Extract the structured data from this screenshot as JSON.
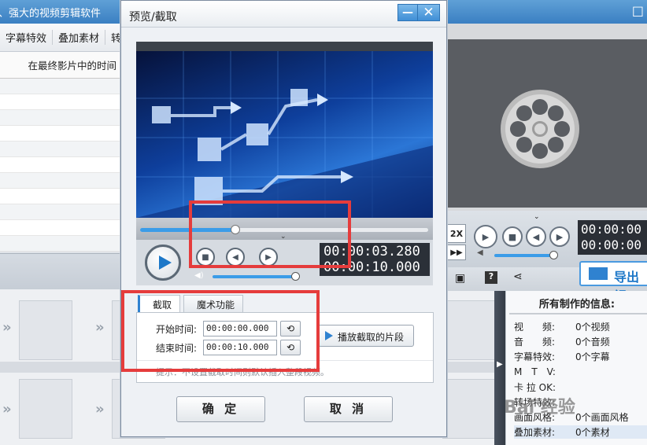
{
  "app": {
    "title": "、强大的视频剪辑软件",
    "tabs": [
      "字幕特效",
      "叠加素材",
      "转"
    ],
    "column_header": "在最终影片中的时间"
  },
  "preview": {
    "time_current": "00:00:00",
    "time_total": "00:00:00",
    "speed_label": "2X",
    "export_label": "导出视"
  },
  "info": {
    "title": "所有制作的信息:",
    "rows": [
      {
        "label": "视　　频:",
        "value": "0个视频"
      },
      {
        "label": "音　　频:",
        "value": "0个音频"
      },
      {
        "label": "字幕特效:",
        "value": "0个字幕"
      },
      {
        "label": "M　T　V:",
        "value": ""
      },
      {
        "label": "卡 拉 OK:",
        "value": ""
      },
      {
        "label": "转场特效:",
        "value": ""
      },
      {
        "label": "画面风格:",
        "value": "0个画面风格"
      },
      {
        "label": "叠加素材:",
        "value": "0个素材"
      }
    ]
  },
  "dialog": {
    "title": "预览/截取",
    "min_label": "—",
    "close_label": "✕",
    "time_current": "00:00:03.280",
    "time_total": "00:00:10.000",
    "progress": 0.33,
    "volume": 0.95,
    "tabs": [
      "截取",
      "魔术功能"
    ],
    "start_label": "开始时间:",
    "start_value": "00:00:00.000",
    "end_label": "结束时间:",
    "end_value": "00:00:10.000",
    "play_clip_label": "播放截取的片段",
    "hint": "提示：不设置截取时间则默认插入整段视频。",
    "ok_label": "确 定",
    "cancel_label": "取 消"
  },
  "watermark": "Bai 经验",
  "colors": {
    "accent": "#2f82d0",
    "highlight_box": "#e53c3c",
    "title_bar": "#3a7fc2"
  }
}
